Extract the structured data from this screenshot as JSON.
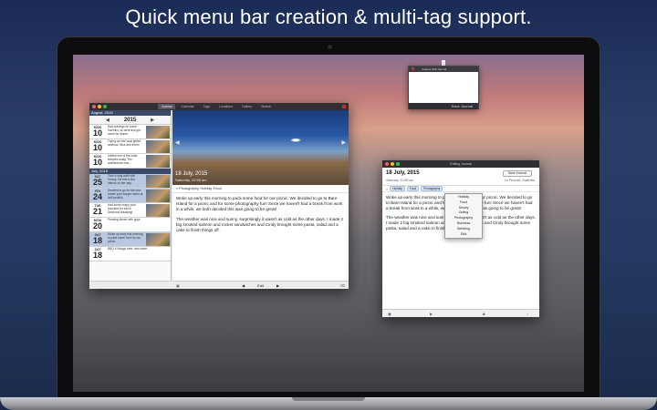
{
  "headline": "Quick menu bar creation & multi-tag support.",
  "menubar_popup": {
    "title": "Capture 365 Journal",
    "save_label": "Save Journal"
  },
  "main_window": {
    "tabs": [
      "Journal",
      "Calendar",
      "Tags",
      "Locations",
      "Gallery",
      "Search"
    ],
    "sidebar": {
      "month_header": "August, 2015",
      "year": "2015",
      "july_header": "July, 2015",
      "entries": [
        {
          "day": "MON",
          "num": "10",
          "text": "Had cravings for some Gazmini, so went and got some for dinner.",
          "thumb": true,
          "highlight": false
        },
        {
          "day": "MON",
          "num": "10",
          "text": "Trying out the local grilled seafood. Nice and fresh!",
          "thumb": true,
          "highlight": false
        },
        {
          "day": "MON",
          "num": "10",
          "text": "Visited one of the older temples today. The architecture was...",
          "thumb": true,
          "highlight": false
        },
        {
          "day": "SAT",
          "num": "25",
          "text": "Took a long walk with Snowy. He met a few friends on the way.",
          "thumb": true,
          "highlight": true
        },
        {
          "day": "FRI",
          "num": "24",
          "text": "Decided to go for the new create your burger menu at McDonald's",
          "thumb": true,
          "highlight": true
        },
        {
          "day": "TUE",
          "num": "21",
          "text": "Had some crispy pork knuckles for lunch. Delicious crackling!",
          "thumb": true,
          "highlight": false
        },
        {
          "day": "MON",
          "num": "20",
          "text": "Pending dinner with guys",
          "thumb": false,
          "highlight": false
        },
        {
          "day": "SAT",
          "num": "18",
          "text": "Woke up early this morning to pack some food for our picnic.",
          "thumb": true,
          "highlight": true
        },
        {
          "day": "SAT",
          "num": "18",
          "text": "BBQ-4 Mango beer, and some...",
          "thumb": false,
          "highlight": false
        }
      ]
    },
    "photo_date": "18 July, 2015",
    "photo_time": "Saturday, 10:55 am",
    "tags_line": "Photography, Holiday, Food",
    "body": [
      "Woke up early this morning to pack some food for our picnic. We decided to go to Bare Island for a picnic and for some photography fun! Since we haven't had a break from work in a while, we both decided this was going to be great!",
      "The weather was nice and sunny, surprisingly it wasn't as cold as the other days. I made 2 big smoked salmon and rocket sandwiches and Cindy brought some pasta, salad and a cake to finish things off."
    ],
    "footer": {
      "prev": "◀",
      "edit": "Edit",
      "next": "▶"
    }
  },
  "edit_window": {
    "title": "Editing Journal",
    "date": "18 July, 2015",
    "time": "Saturday, 10:55 am",
    "save_label": "Save Journal",
    "location": "La Perouse, Australia",
    "chips": [
      "Holiday",
      "Food",
      "Photography"
    ],
    "dropdown": [
      "Holiday",
      "Food",
      "Snowy",
      "Outing",
      "Photography",
      "Business",
      "Wedding",
      "Sick"
    ],
    "body": [
      "Woke up early this morning to pack some food for our picnic. We decided to go to Bare Island for a picnic and for some photography fun! Since we haven't had a break from work in a while, we both decided this was going to be great!",
      "The weather was nice and sunny, surprisingly it wasn't as cold as the other days. I made 2 big smoked salmon and rocket sandwiches and Cindy brought some pasta, salad and a cake to finish things off."
    ]
  }
}
